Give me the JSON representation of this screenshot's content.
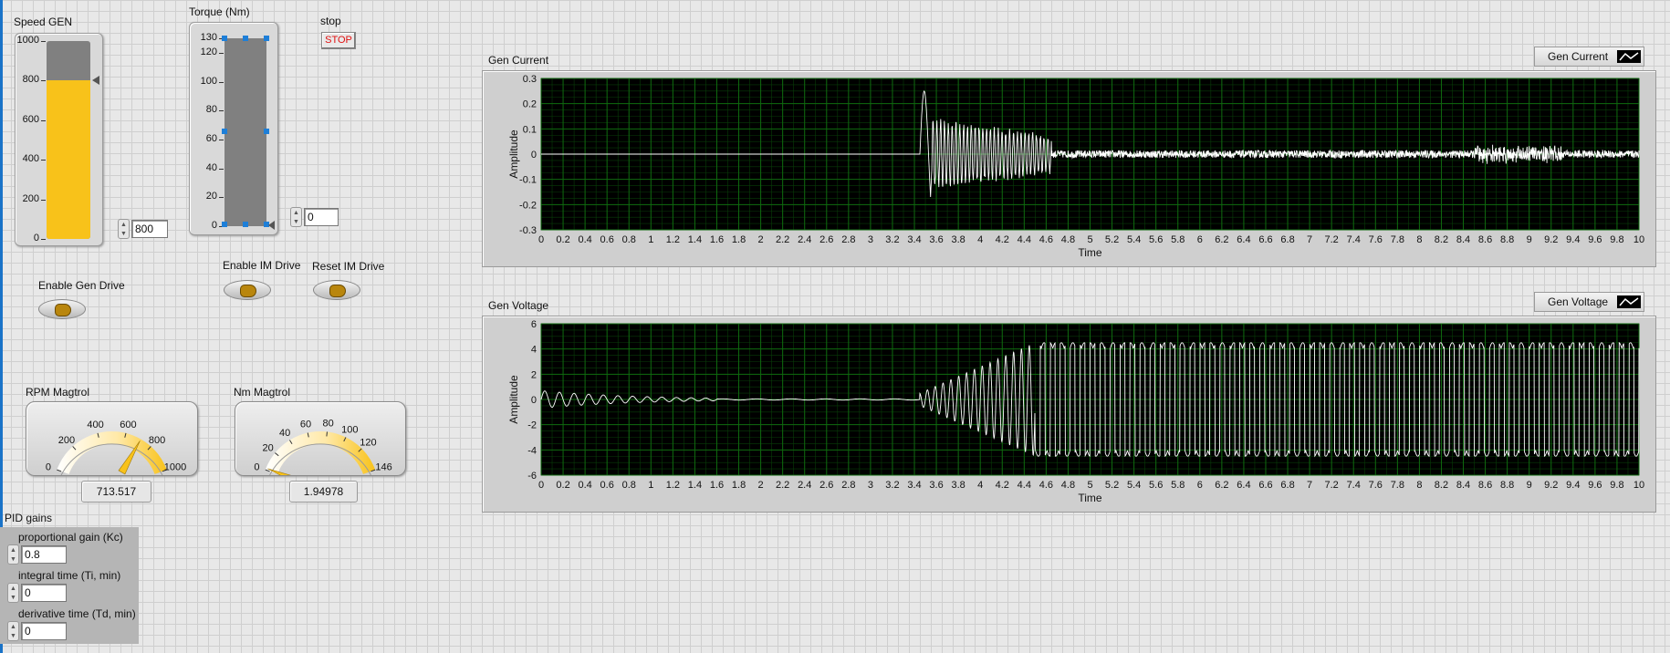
{
  "speed": {
    "label": "Speed  GEN",
    "ticks": [
      "1000",
      "800",
      "600",
      "400",
      "200",
      "0"
    ],
    "value": 800,
    "value_text": "800",
    "max": 1000
  },
  "torque": {
    "label": "Torque (Nm)",
    "ticks": [
      "130",
      "120",
      "100",
      "80",
      "60",
      "40",
      "20",
      "0"
    ],
    "value": 0,
    "value_text": "0",
    "max": 130
  },
  "stop": {
    "label": "stop",
    "button": "STOP"
  },
  "buttons": {
    "enable_gen_drive": "Enable Gen Drive",
    "enable_im_drive": "Enable IM Drive",
    "reset_im_drive": "Reset IM Drive"
  },
  "rpm_gauge": {
    "label": "RPM Magtrol",
    "ticks": [
      "0",
      "200",
      "400",
      "600",
      "800",
      "1000"
    ],
    "min": 0,
    "max": 1000,
    "value": 713.517,
    "value_text": "713.517"
  },
  "nm_gauge": {
    "label": "Nm Magtrol",
    "ticks": [
      "0",
      "20",
      "40",
      "60",
      "80",
      "100",
      "120",
      "146"
    ],
    "min": 0,
    "max": 146,
    "value": 1.94978,
    "value_text": "1.94978"
  },
  "pid": {
    "title": "PID gains",
    "kc_label": "proportional gain (Kc)",
    "kc_value": "0.8",
    "ti_label": "integral time (Ti, min)",
    "ti_value": "0",
    "td_label": "derivative time (Td, min)",
    "td_value": "0"
  },
  "current_graph": {
    "title": "Gen Current",
    "legend": "Gen Current",
    "xlabel": "Time",
    "ylabel": "Amplitude",
    "xlim": [
      0,
      10
    ],
    "ylim": [
      -0.3,
      0.3
    ],
    "yticks": [
      "0.3",
      "0.2",
      "0.1",
      "0",
      "-0.1",
      "-0.2",
      "-0.3"
    ],
    "xticks": [
      "0",
      "0.2",
      "0.4",
      "0.6",
      "0.8",
      "1",
      "1.2",
      "1.4",
      "1.6",
      "1.8",
      "2",
      "2.2",
      "2.4",
      "2.6",
      "2.8",
      "3",
      "3.2",
      "3.4",
      "3.6",
      "3.8",
      "4",
      "4.2",
      "4.4",
      "4.6",
      "4.8",
      "5",
      "5.2",
      "5.4",
      "5.6",
      "5.8",
      "6",
      "6.2",
      "6.4",
      "6.6",
      "6.8",
      "7",
      "7.2",
      "7.4",
      "7.6",
      "7.8",
      "8",
      "8.2",
      "8.4",
      "8.6",
      "8.8",
      "9",
      "9.2",
      "9.4",
      "9.6",
      "9.8",
      "10"
    ]
  },
  "voltage_graph": {
    "title": "Gen Voltage",
    "legend": "Gen Voltage",
    "xlabel": "Time",
    "ylabel": "Amplitude",
    "xlim": [
      0,
      10
    ],
    "ylim": [
      -6,
      6
    ],
    "yticks": [
      "6",
      "4",
      "2",
      "0",
      "-2",
      "-4",
      "-6"
    ],
    "xticks": [
      "0",
      "0.2",
      "0.4",
      "0.6",
      "0.8",
      "1",
      "1.2",
      "1.4",
      "1.6",
      "1.8",
      "2",
      "2.2",
      "2.4",
      "2.6",
      "2.8",
      "3",
      "3.2",
      "3.4",
      "3.6",
      "3.8",
      "4",
      "4.2",
      "4.4",
      "4.6",
      "4.8",
      "5",
      "5.2",
      "5.4",
      "5.6",
      "5.8",
      "6",
      "6.2",
      "6.4",
      "6.6",
      "6.8",
      "7",
      "7.2",
      "7.4",
      "7.6",
      "7.8",
      "8",
      "8.2",
      "8.4",
      "8.6",
      "8.8",
      "9",
      "9.2",
      "9.4",
      "9.6",
      "9.8",
      "10"
    ]
  },
  "colors": {
    "plot_bg": "#000000",
    "plot_grid": "#0f6a0f",
    "trace": "#ffffff",
    "fill": "#f8c21a",
    "track": "#808080"
  }
}
